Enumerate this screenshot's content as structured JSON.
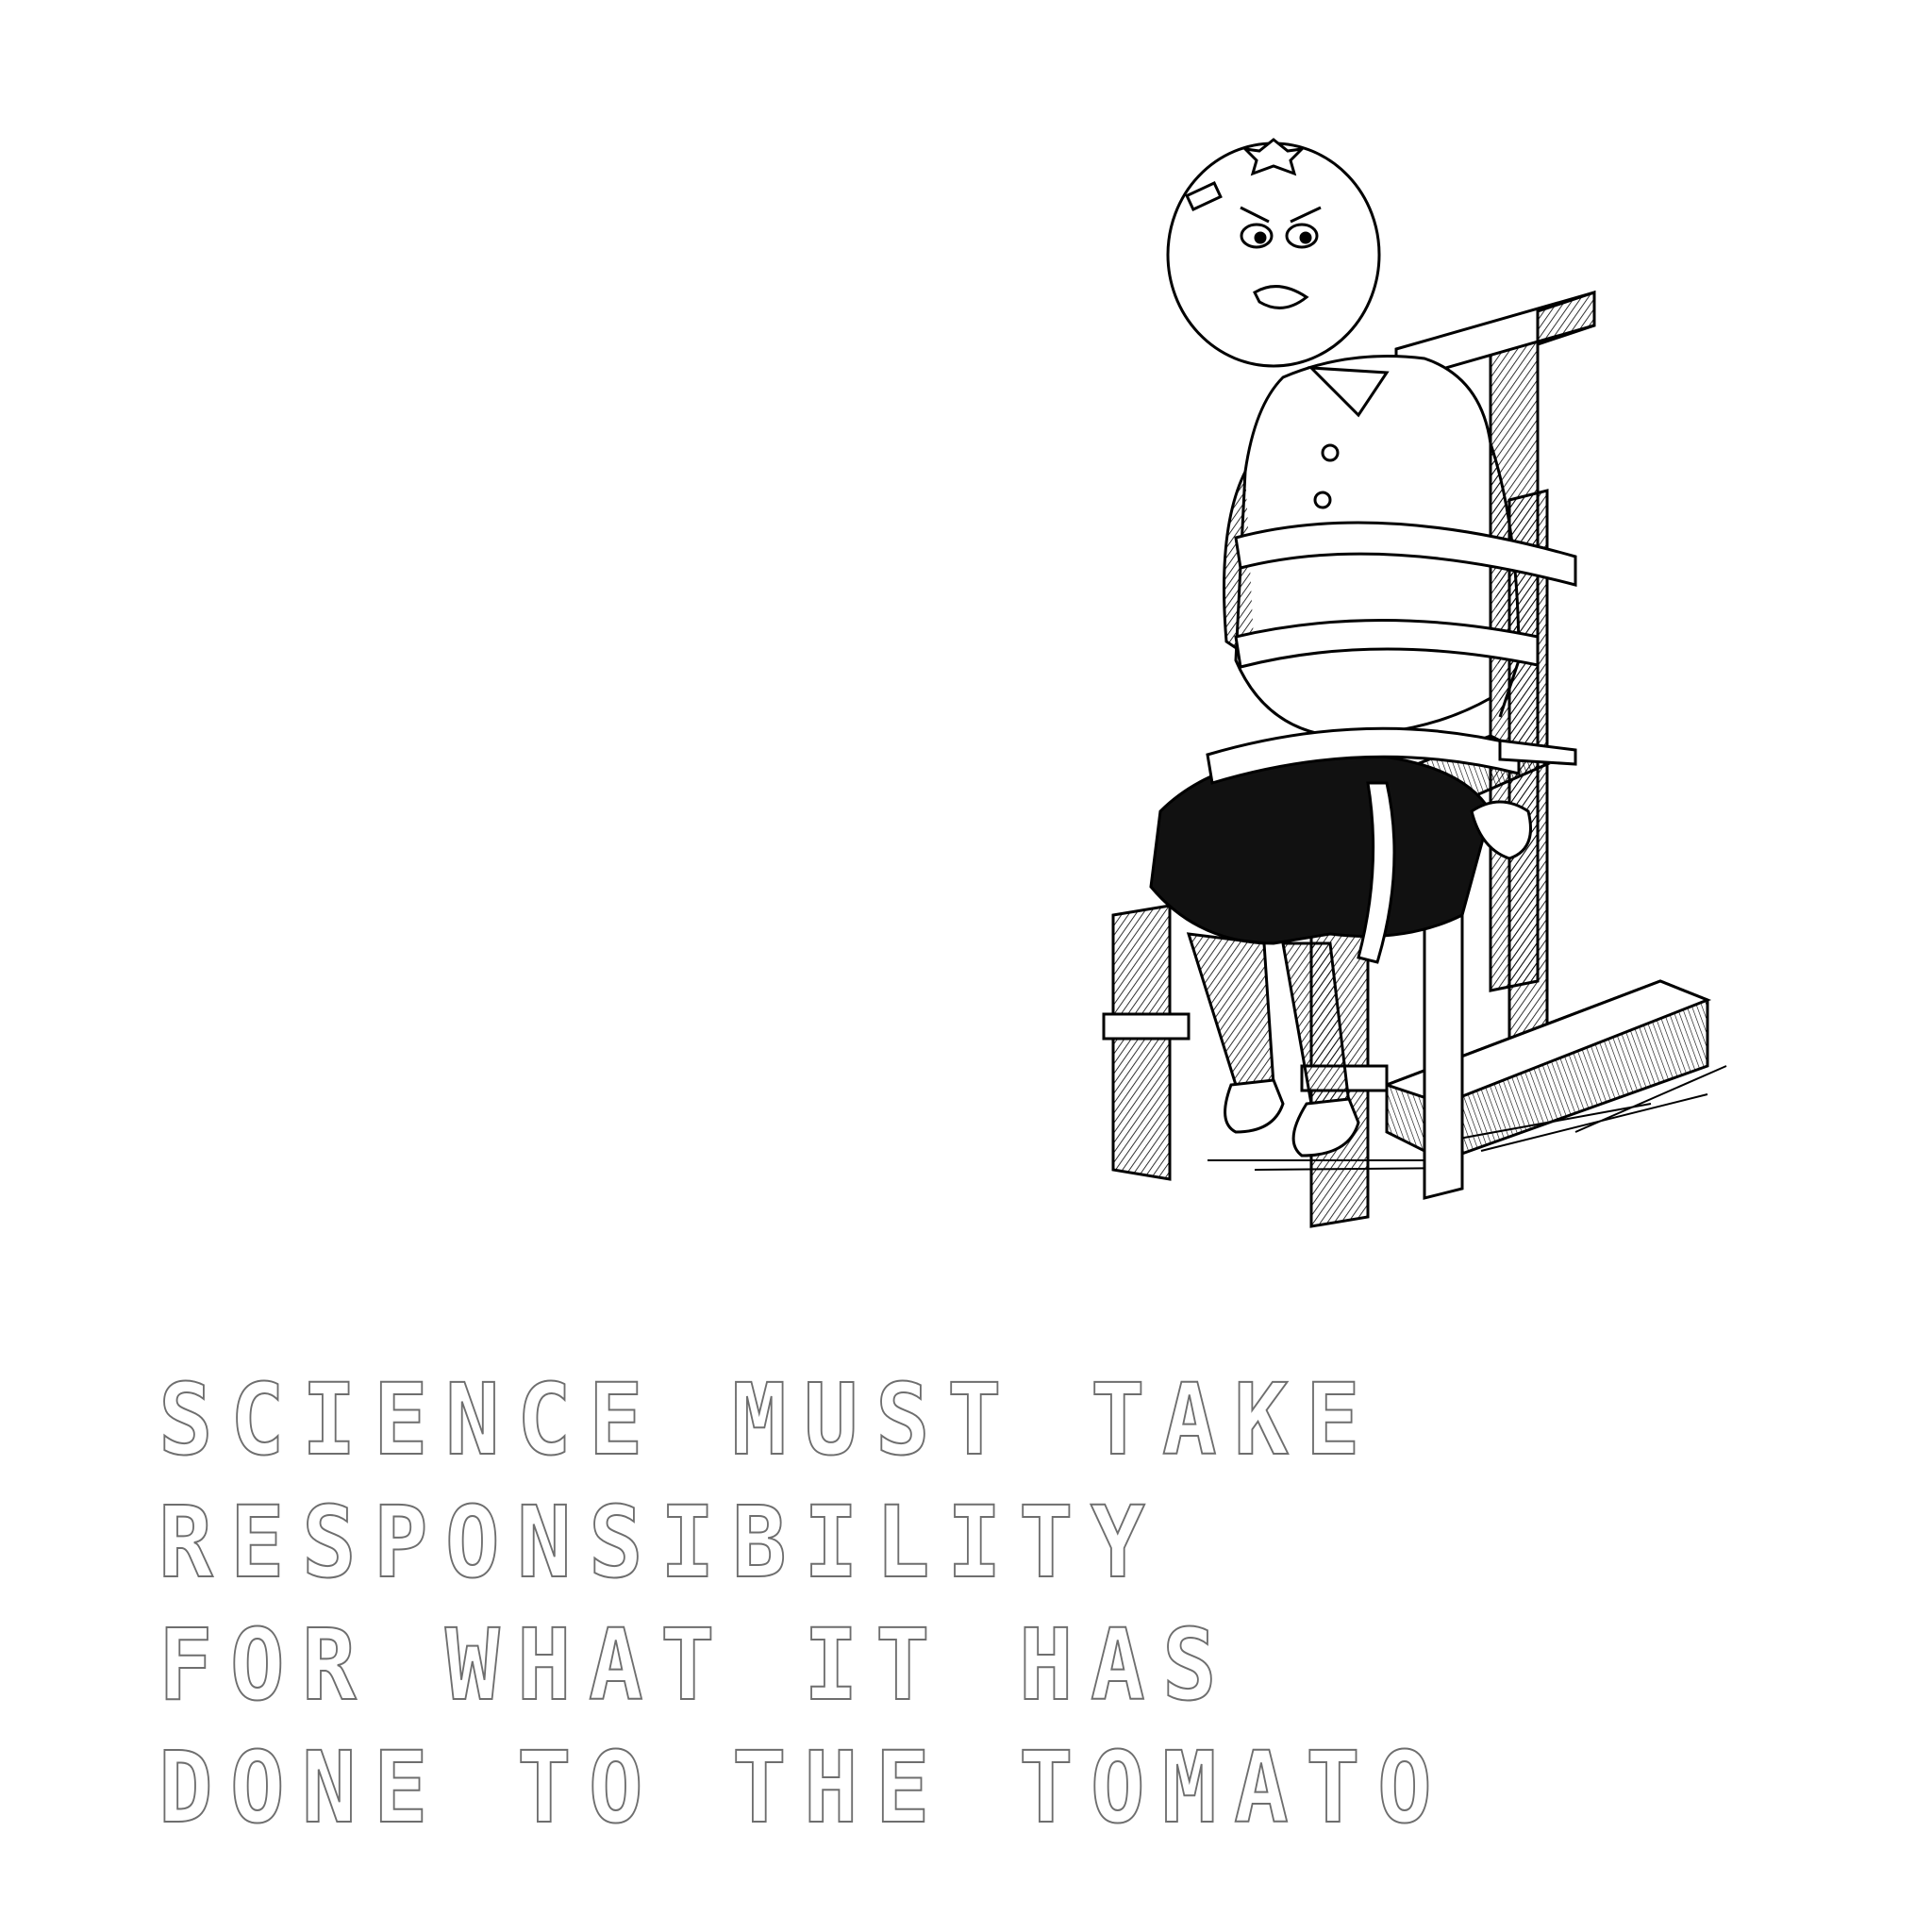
{
  "illustration": {
    "subject": "cartoon tomato-headed figure strapped into a wooden chair",
    "style": "black-and-white engraving",
    "ink_color": "#000000",
    "paper_color": "#ffffff"
  },
  "caption": {
    "lines": [
      "SCIENCE MUST TAKE",
      "RESPONSIBILITY",
      "FOR WHAT IT HAS",
      "DONE TO THE TOMATO"
    ],
    "outline_color": "#6e6e6e"
  }
}
